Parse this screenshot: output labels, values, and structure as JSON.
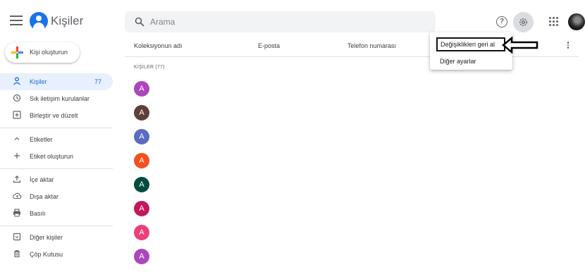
{
  "app": {
    "title": "Kişiler"
  },
  "search": {
    "placeholder": "Arama"
  },
  "sidebar": {
    "create_label": "Kişi oluşturun",
    "items": [
      {
        "icon": "person-icon",
        "label": "Kişiler",
        "count": "77"
      },
      {
        "icon": "history-icon",
        "label": "Sık iletişim kurulanlar"
      },
      {
        "icon": "merge-icon",
        "label": "Birleştir ve düzelt"
      },
      {
        "icon": "chevron-up-icon",
        "label": "Etiketler"
      },
      {
        "icon": "plus-icon",
        "label": "Etiket oluşturun"
      },
      {
        "icon": "upload-icon",
        "label": "İçe aktar"
      },
      {
        "icon": "cloud-upload-icon",
        "label": "Dışa aktar"
      },
      {
        "icon": "print-icon",
        "label": "Basılı"
      },
      {
        "icon": "archive-icon",
        "label": "Diğer kişiler"
      },
      {
        "icon": "trash-icon",
        "label": "Çöp Kutusu"
      }
    ]
  },
  "main": {
    "columns": [
      "Koleksiyonun adı",
      "E-posta",
      "Telefon numarası"
    ],
    "section_label": "KİŞİLER (77)",
    "contacts": [
      {
        "initial": "A",
        "color": "#ab47bc"
      },
      {
        "initial": "A",
        "color": "#5d4037"
      },
      {
        "initial": "A",
        "color": "#5c6bc0"
      },
      {
        "initial": "A",
        "color": "#f4511e"
      },
      {
        "initial": "A",
        "color": "#004d40"
      },
      {
        "initial": "A",
        "color": "#c2185b"
      },
      {
        "initial": "A",
        "color": "#ec407a"
      },
      {
        "initial": "A",
        "color": "#ab47bc"
      }
    ]
  },
  "settings_menu": {
    "items": [
      "Değişiklikleri geri al",
      "Diğer ayarlar"
    ]
  },
  "header": {
    "help_glyph": "?"
  },
  "colors": {
    "accent": "#1a73e8",
    "active_bg": "#e8f0fe"
  }
}
